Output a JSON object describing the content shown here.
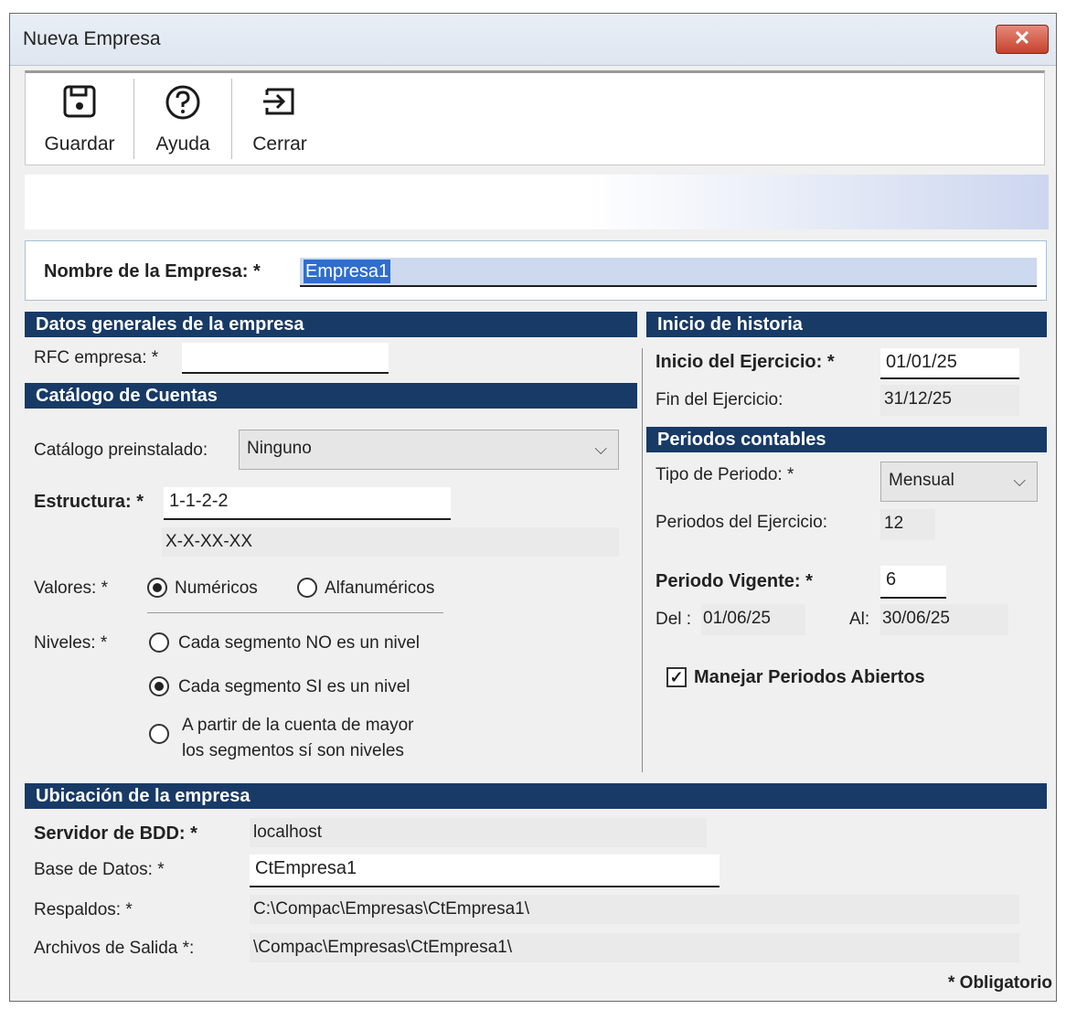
{
  "window": {
    "title": "Nueva Empresa",
    "close_glyph": "✕"
  },
  "toolbar": {
    "save_label": "Guardar",
    "help_label": "Ayuda",
    "close_label": "Cerrar"
  },
  "company_name": {
    "label": "Nombre de la Empresa: *",
    "value": "Empresa1"
  },
  "general": {
    "header": "Datos generales de la empresa",
    "rfc_label": "RFC empresa: *",
    "rfc_value": ""
  },
  "catalog": {
    "header": "Catálogo de Cuentas",
    "preinstalled_label": "Catálogo preinstalado:",
    "preinstalled_value": "Ninguno",
    "structure_label": "Estructura: *",
    "structure_value": "1-1-2-2",
    "structure_mask": "X-X-XX-XX",
    "values_label": "Valores: *",
    "values_options": [
      "Numéricos",
      "Alfanuméricos"
    ],
    "values_selected": "Numéricos",
    "levels_label": "Niveles: *",
    "levels_options": [
      "Cada segmento NO es un nivel",
      "Cada segmento SI es un nivel",
      "A partir de la cuenta de mayor",
      "los segmentos sí son niveles"
    ],
    "levels_selected": "Cada segmento SI es un nivel"
  },
  "history": {
    "header": "Inicio de historia",
    "start_label": "Inicio del Ejercicio: *",
    "start_value": "01/01/25",
    "end_label": "Fin del Ejercicio:",
    "end_value": "31/12/25"
  },
  "periods": {
    "header": "Periodos contables",
    "type_label": "Tipo de Periodo: *",
    "type_value": "Mensual",
    "count_label": "Periodos del Ejercicio:",
    "count_value": "12",
    "current_label": "Periodo Vigente: *",
    "current_value": "6",
    "from_label": "Del :",
    "from_value": "01/06/25",
    "to_label": "Al:",
    "to_value": "30/06/25",
    "open_periods_label": "Manejar Periodos Abiertos",
    "open_periods_checked": true
  },
  "location": {
    "header": "Ubicación de la empresa",
    "server_label": "Servidor de BDD: *",
    "server_value": "localhost",
    "db_label": "Base de Datos: *",
    "db_value": "CtEmpresa1",
    "backup_label": "Respaldos: *",
    "backup_value": "C:\\Compac\\Empresas\\CtEmpresa1\\",
    "output_label": "Archivos de Salida *:",
    "output_value": "\\Compac\\Empresas\\CtEmpresa1\\"
  },
  "footer": {
    "required_note": "* Obligatorio"
  },
  "colors": {
    "section_header": "#173a67",
    "selection": "#cdd9ee"
  },
  "icons": {
    "save": "save-icon",
    "help": "help-icon",
    "close": "exit-icon",
    "dropdown": "chevron-down-icon"
  }
}
